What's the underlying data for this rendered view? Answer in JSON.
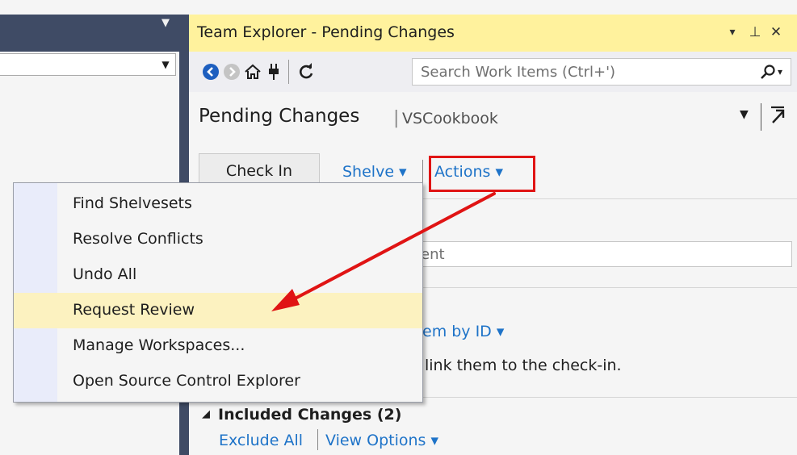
{
  "left_panel": {
    "title_dropdown_icon": "dropdown-triangle",
    "combo_value": ""
  },
  "team_explorer": {
    "title": "Team Explorer - Pending Changes",
    "title_buttons": {
      "dropdown": "▾",
      "pin": "⊥",
      "close": "✕"
    },
    "toolbar": {
      "icons": [
        "back-icon",
        "forward-icon",
        "home-icon",
        "connect-icon",
        "refresh-icon"
      ],
      "search_placeholder": "Search Work Items (Ctrl+')"
    },
    "header": {
      "title": "Pending Changes",
      "separator": "|",
      "subtitle": "VSCookbook"
    },
    "actions_bar": {
      "check_in": "Check In",
      "shelve": "Shelve ▾",
      "actions": "Actions ▾"
    },
    "comment_peek": "ent",
    "work_items_peek": "em by ID ▾",
    "work_items_hint_peek": "link them to the check-in.",
    "included_changes": {
      "title": "Included Changes (2)",
      "exclude_all": "Exclude All",
      "view_options": "View Options ▾"
    }
  },
  "actions_menu": {
    "items": [
      {
        "label": "Find Shelvesets"
      },
      {
        "label": "Resolve Conflicts"
      },
      {
        "label": "Undo All"
      },
      {
        "label": "Request Review"
      },
      {
        "label": "Manage Workspaces..."
      },
      {
        "label": "Open Source Control Explorer"
      }
    ],
    "highlighted": "Request Review"
  },
  "annotation": {
    "color": "#e01414"
  }
}
